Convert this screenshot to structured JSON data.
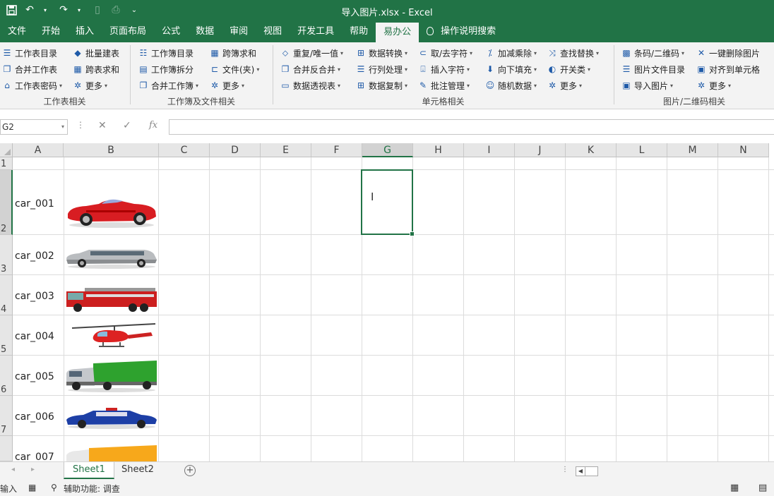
{
  "window": {
    "title": "导入图片.xlsx  -  Excel"
  },
  "tabs": [
    "文件",
    "开始",
    "插入",
    "页面布局",
    "公式",
    "数据",
    "审阅",
    "视图",
    "开发工具",
    "帮助",
    "易办公"
  ],
  "active_tab": "易办公",
  "tell_me": "操作说明搜索",
  "ribbon": {
    "groups": [
      {
        "label": "工作表相关"
      },
      {
        "label": "工作簿及文件相关"
      },
      {
        "label": "单元格相关"
      },
      {
        "label": "图片/二维码相关"
      }
    ],
    "items": [
      "工作表目录",
      "批量建表",
      "合并工作表",
      "跨表求和",
      "工作表密码",
      "更多",
      "工作簿目录",
      "跨簿求和",
      "工作簿拆分",
      "文件(夹)",
      "合并工作簿",
      "更多",
      "重复/唯一值",
      "数据转换",
      "取/去字符",
      "加减乘除",
      "查找替换",
      "合并反合并",
      "行列处理",
      "插入字符",
      "向下填充",
      "开关类",
      "数据透视表",
      "数据复制",
      "批注管理",
      "随机数据",
      "更多",
      "条码/二维码",
      "一键删除图片",
      "图片文件目录",
      "对齐到单元格",
      "导入图片",
      "更多"
    ]
  },
  "formula_bar": {
    "name_box": "G2",
    "formula": ""
  },
  "columns": [
    "A",
    "B",
    "C",
    "D",
    "E",
    "F",
    "G",
    "H",
    "I",
    "J",
    "K",
    "L",
    "M",
    "N"
  ],
  "selected_column": "G",
  "rows": [
    "1",
    "2",
    "3",
    "4",
    "5",
    "6",
    "7"
  ],
  "cells": [
    "car_001",
    "car_002",
    "car_003",
    "car_004",
    "car_005",
    "car_006",
    "car_007"
  ],
  "pictures": [
    "red-convertible",
    "silver-limousine",
    "red-fire-truck",
    "red-helicopter",
    "green-box-truck",
    "blue-police-car",
    "orange-truck"
  ],
  "sheets": [
    "Sheet1",
    "Sheet2"
  ],
  "active_sheet": "Sheet1",
  "status": {
    "mode": "输入",
    "accessibility": "辅助功能: 调查"
  },
  "colors": {
    "accent": "#217346"
  }
}
